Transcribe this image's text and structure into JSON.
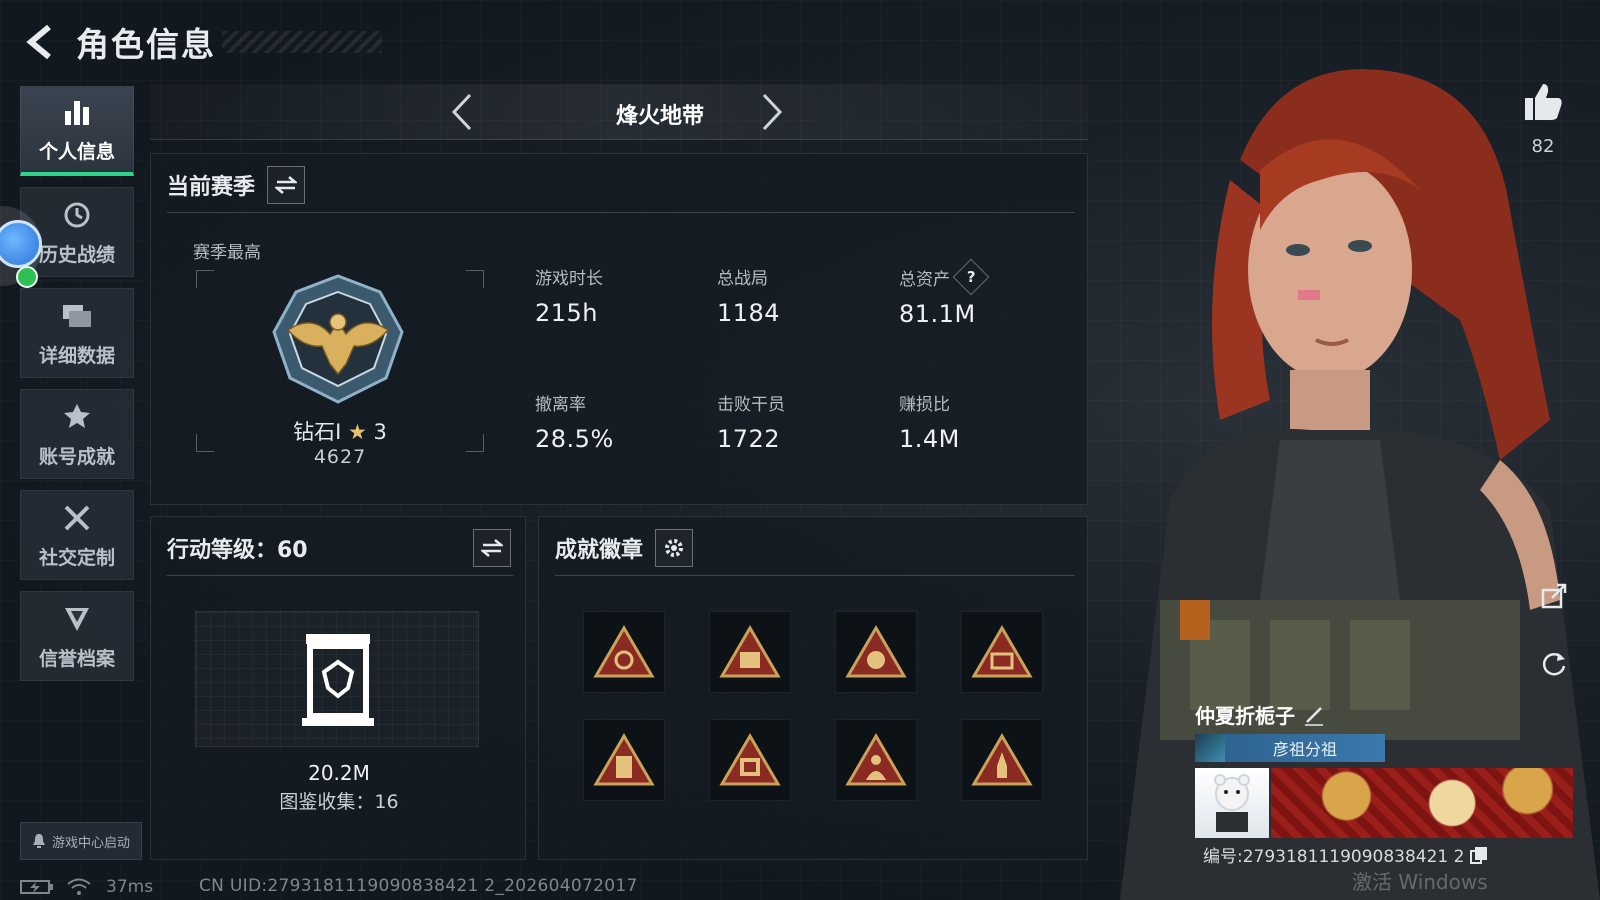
{
  "header": {
    "title": "角色信息",
    "back_icon": "back-arrow-icon"
  },
  "sidebar": {
    "items": [
      {
        "label": "个人信息",
        "icon": "bar-chart-icon",
        "active": true
      },
      {
        "label": "历史战绩",
        "icon": "history-clock-icon",
        "active": false
      },
      {
        "label": "详细数据",
        "icon": "stacked-cards-icon",
        "active": false
      },
      {
        "label": "账号成就",
        "icon": "achievement-star-icon",
        "active": false
      },
      {
        "label": "社交定制",
        "icon": "wrench-tools-icon",
        "active": false
      },
      {
        "label": "信誉档案",
        "icon": "shield-chevron-icon",
        "active": false
      }
    ],
    "launch_label": "游戏中心启动"
  },
  "mode_selector": {
    "name": "烽火地带"
  },
  "season_panel": {
    "title": "当前赛季",
    "subtitle": "赛季最高",
    "rank": {
      "name": "钻石I",
      "star": "★",
      "stars": "3",
      "points": "4627"
    },
    "stats": [
      {
        "label": "游戏时长",
        "value": "215h"
      },
      {
        "label": "总战局",
        "value": "1184"
      },
      {
        "label": "总资产",
        "value": "81.1M",
        "help": "?"
      },
      {
        "label": "撤离率",
        "value": "28.5%"
      },
      {
        "label": "击败干员",
        "value": "1722"
      },
      {
        "label": "赚损比",
        "value": "1.4M"
      }
    ]
  },
  "level_panel": {
    "title": "行动等级：60",
    "value": "20.2M",
    "collection": "图鉴收集：16"
  },
  "badge_panel": {
    "title": "成就徽章",
    "badges": [
      "badge-emblem",
      "badge-s4",
      "badge-s5",
      "badge-s6",
      "badge-s7",
      "badge-s8",
      "badge-figure",
      "badge-rocket"
    ]
  },
  "status_bar": {
    "ping": "37ms",
    "uid": "CN UID:2793181119090838421 2_202604072017"
  },
  "character": {
    "likes": "82"
  },
  "player": {
    "name": "仲夏折栀子",
    "clan": "彦祖分祖",
    "id": "编号:2793181119090838421 2"
  },
  "watermark": "激活 Windows",
  "colors": {
    "accent_green": "#2fd68a",
    "badge_gold": "#c9a25a",
    "badge_red": "#8a2a22"
  }
}
